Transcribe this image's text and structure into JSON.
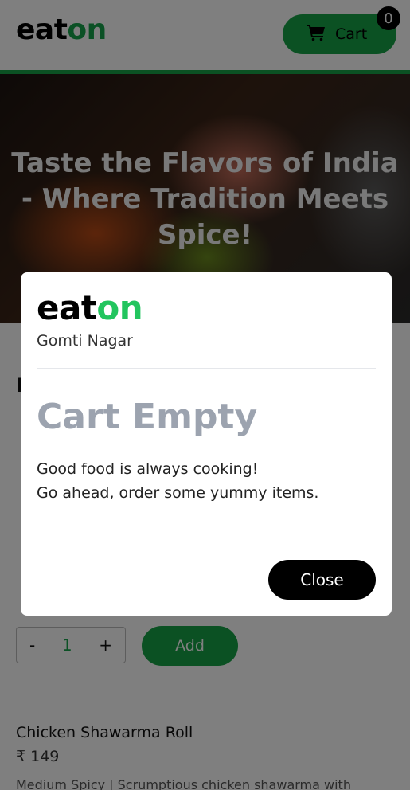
{
  "header": {
    "logo": {
      "eat": "eat",
      "on": "on"
    },
    "cart_label": "Cart",
    "cart_count": "0",
    "icon": "shopping-cart-icon"
  },
  "hero": {
    "title": "Taste the Flavors of India - Where Tradition Meets Spice!"
  },
  "menu": {
    "qty_minus": "-",
    "qty_value": "1",
    "qty_plus": "+",
    "add_label": "Add",
    "item2": {
      "name": "Chicken Shawarma Roll",
      "price": "₹ 149",
      "description": "Medium Spicy | Scrumptious chicken shawarma with"
    }
  },
  "modal": {
    "logo": {
      "eat": "eat",
      "on": "on"
    },
    "location": "Gomti Nagar",
    "title": "Cart Empty",
    "line1": "Good food is always cooking!",
    "line2": "Go ahead, order some yummy items.",
    "close_label": "Close"
  },
  "colors": {
    "brand_green": "#17a346",
    "logo_green": "#22c55e",
    "title_gray": "#9ca3af"
  }
}
